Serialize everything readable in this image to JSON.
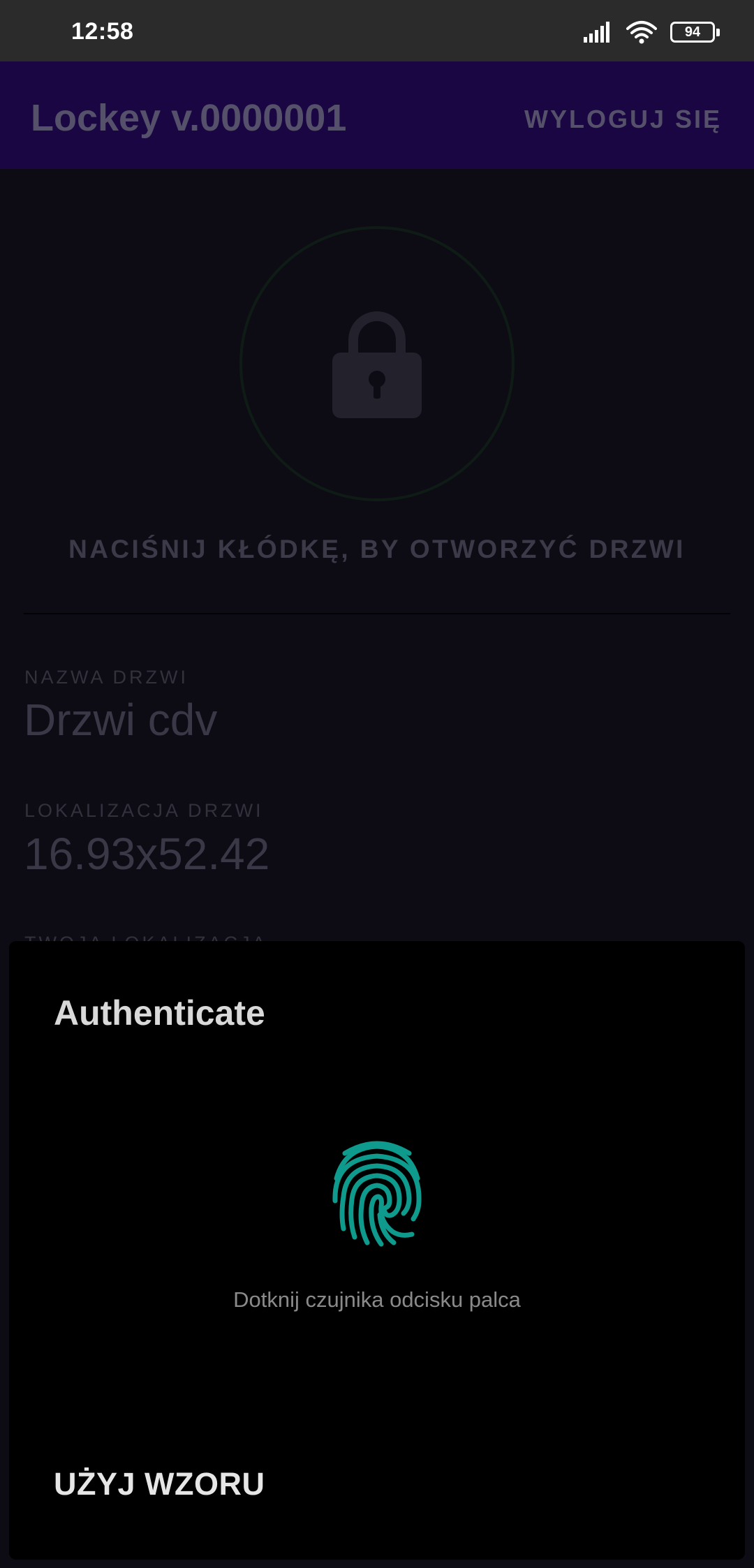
{
  "status_bar": {
    "time": "12:58",
    "battery": "94",
    "icons": [
      "signal-icon",
      "wifi-icon",
      "battery-icon"
    ]
  },
  "app_bar": {
    "title": "Lockey v.0000001",
    "logout_label": "WYLOGUJ SIĘ",
    "color": "#1a0642"
  },
  "main": {
    "lock_icon": "lock-icon",
    "lock_hint": "NACIŚNIJ KŁÓDKĘ, BY OTWORZYĆ DRZWI",
    "door_name_label": "NAZWA DRZWI",
    "door_name_value": "Drzwi cdv",
    "door_location_label": "LOKALIZACJA DRZWI",
    "door_location_value": "16.93x52.42",
    "your_location_label": "TWOJA LOKALIZACJA"
  },
  "auth_dialog": {
    "title": "Authenticate",
    "fingerprint_icon": "fingerprint-icon",
    "hint": "Dotknij czujnika odcisku palca",
    "use_pattern_label": "UŻYJ WZORU",
    "accent": "#0e9a8c"
  }
}
